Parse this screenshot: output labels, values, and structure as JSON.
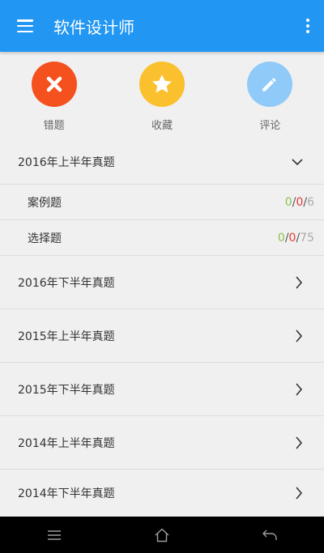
{
  "appbar": {
    "title": "软件设计师",
    "menu_icon": "hamburger-menu-icon",
    "more_icon": "more-vert-icon",
    "color": "#2196f3"
  },
  "actions": [
    {
      "label": "错题",
      "icon": "close-icon",
      "color": "#f4511e"
    },
    {
      "label": "收藏",
      "icon": "star-icon",
      "color": "#fbc02d"
    },
    {
      "label": "评论",
      "icon": "pencil-icon",
      "color": "#90caf9"
    }
  ],
  "sections": [
    {
      "title": "2016年上半年真题",
      "expanded": true,
      "items": [
        {
          "label": "案例题",
          "correct": "0",
          "wrong": "0",
          "total": "6"
        },
        {
          "label": "选择题",
          "correct": "0",
          "wrong": "0",
          "total": "75"
        }
      ]
    },
    {
      "title": "2016年下半年真题",
      "expanded": false
    },
    {
      "title": "2015年上半年真题",
      "expanded": false
    },
    {
      "title": "2015年下半年真题",
      "expanded": false
    },
    {
      "title": "2014年上半年真题",
      "expanded": false
    },
    {
      "title": "2014年下半年真题",
      "expanded": false
    }
  ],
  "score_separator": "/",
  "nav": {
    "menu_icon": "nav-menu-icon",
    "home_icon": "home-icon",
    "back_icon": "back-icon"
  }
}
